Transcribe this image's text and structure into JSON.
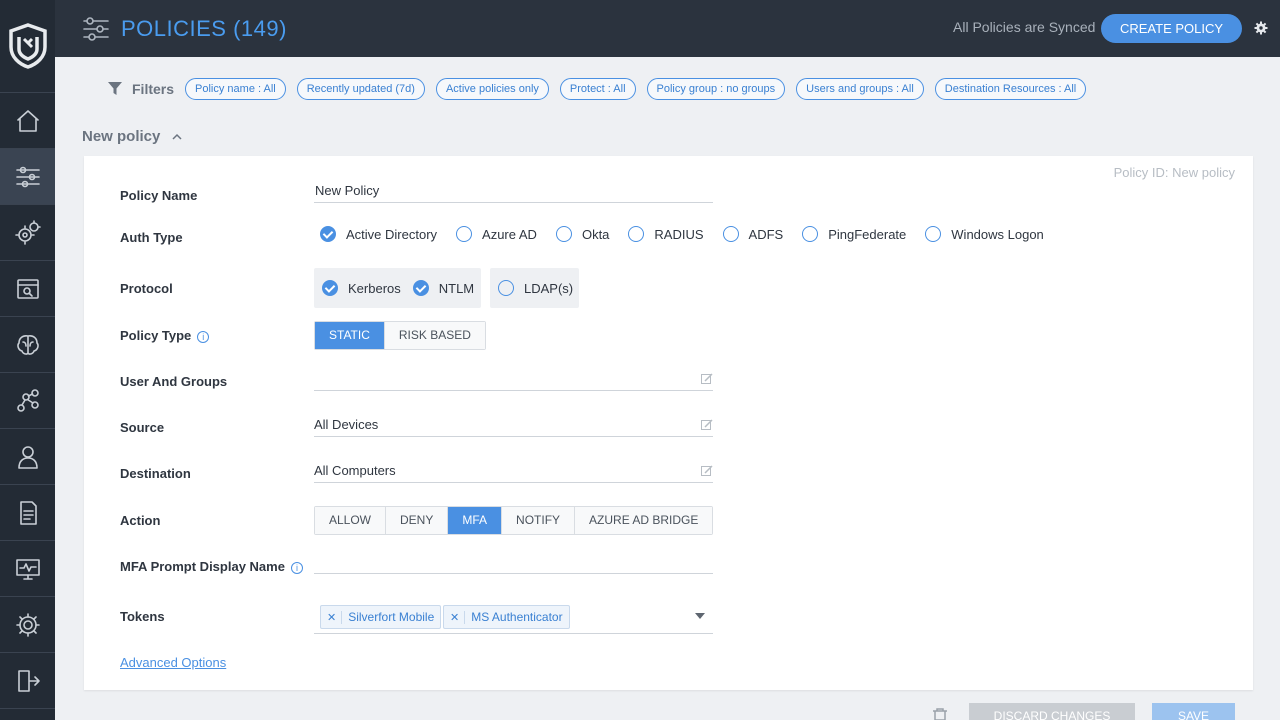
{
  "header": {
    "title": "POLICIES (149)",
    "sync_status": "All Policies are Synced",
    "create_button": "CREATE POLICY"
  },
  "sidebar": {
    "items": [
      {
        "icon": "home-icon"
      },
      {
        "icon": "policies-icon"
      },
      {
        "icon": "settings-gears-icon"
      },
      {
        "icon": "discovery-icon"
      },
      {
        "icon": "brain-icon"
      },
      {
        "icon": "graph-icon"
      },
      {
        "icon": "user-icon"
      },
      {
        "icon": "report-icon"
      },
      {
        "icon": "monitor-icon"
      },
      {
        "icon": "settings-icon"
      },
      {
        "icon": "logout-icon"
      }
    ]
  },
  "filters": {
    "label": "Filters",
    "chips": [
      "Policy name : All",
      "Recently updated (7d)",
      "Active policies only",
      "Protect : All",
      "Policy group : no groups",
      "Users and groups : All",
      "Destination Resources : All"
    ]
  },
  "section": {
    "title": "New policy"
  },
  "form": {
    "policy_id": "Policy ID: New policy",
    "labels": {
      "policy_name": "Policy Name",
      "auth_type": "Auth Type",
      "protocol": "Protocol",
      "policy_type": "Policy Type",
      "users_groups": "User And Groups",
      "source": "Source",
      "destination": "Destination",
      "action": "Action",
      "mfa_prompt": "MFA Prompt Display Name",
      "tokens": "Tokens"
    },
    "policy_name_value": "New Policy",
    "auth_types": [
      {
        "label": "Active Directory",
        "checked": true
      },
      {
        "label": "Azure AD",
        "checked": false
      },
      {
        "label": "Okta",
        "checked": false
      },
      {
        "label": "RADIUS",
        "checked": false
      },
      {
        "label": "ADFS",
        "checked": false
      },
      {
        "label": "PingFederate",
        "checked": false
      },
      {
        "label": "Windows Logon",
        "checked": false
      }
    ],
    "protocols": [
      {
        "label": "Kerberos",
        "checked": true
      },
      {
        "label": "NTLM",
        "checked": true
      },
      {
        "label": "LDAP(s)",
        "checked": false
      }
    ],
    "policy_types": [
      "STATIC",
      "RISK BASED"
    ],
    "policy_type_selected": "STATIC",
    "users_groups_value": "",
    "source_value": "All Devices",
    "destination_value": "All Computers",
    "actions": [
      "ALLOW",
      "DENY",
      "MFA",
      "NOTIFY",
      "AZURE AD BRIDGE"
    ],
    "action_selected": "MFA",
    "mfa_prompt_value": "",
    "tokens": [
      "Silverfort Mobile",
      "MS Authenticator"
    ],
    "advanced_options": "Advanced Options"
  },
  "footer": {
    "discard": "DISCARD CHANGES",
    "save": "SAVE"
  },
  "colors": {
    "accent": "#4a90e2",
    "sidebar": "#232b35",
    "topbar": "#2b333e"
  }
}
